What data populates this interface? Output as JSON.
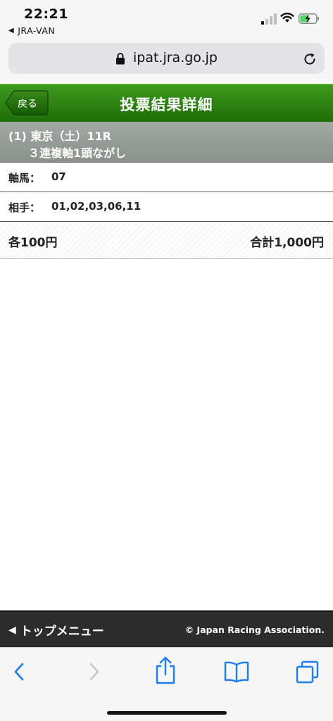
{
  "status_bar": {
    "time": "22:21",
    "back_app": "JRA-VAN",
    "icons": [
      "signal-icon",
      "wifi-icon",
      "battery-charging-icon"
    ]
  },
  "browser": {
    "url": "ipat.jra.go.jp",
    "icons": [
      "lock-icon",
      "reload-icon"
    ]
  },
  "header": {
    "back_label": "戻る",
    "title": "投票結果詳細",
    "color": "#2d8312"
  },
  "race": {
    "line1": "(1) 東京（土）11R",
    "line2": "３連複軸1頭ながし"
  },
  "rows": [
    {
      "label": "軸馬：",
      "value": "07"
    },
    {
      "label": "相手：",
      "value": "01,02,03,06,11"
    }
  ],
  "amount": {
    "each": "各100円",
    "total": "合計1,000円"
  },
  "footer": {
    "menu_label": "トップメニュー",
    "copyright": "© Japan Racing Association."
  },
  "toolbar": {
    "icons": [
      "back-arrow-icon",
      "forward-arrow-icon",
      "share-icon",
      "bookmarks-icon",
      "tabs-icon"
    ],
    "accent": "#1e7cf2"
  }
}
